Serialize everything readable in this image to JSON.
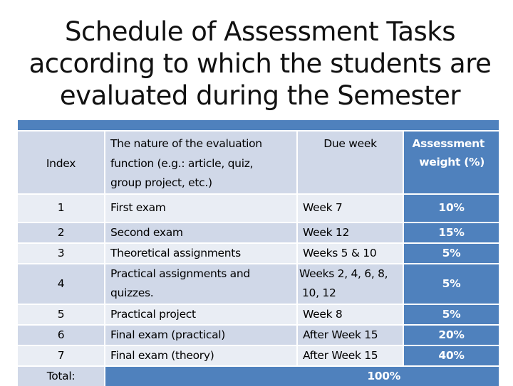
{
  "slide": {
    "title_lines": [
      "Schedule of Assessment Tasks",
      "according to which the students are",
      "evaluated during the Semester"
    ]
  },
  "colors": {
    "accent_blue": "#4f81bd",
    "row_dark": "#d0d8e8",
    "row_light": "#e9edf4"
  },
  "table": {
    "headers": {
      "index": "Index",
      "nature_lines": [
        "The nature of the evaluation",
        "function (e.g.: article, quiz,",
        "group project, etc.)"
      ],
      "due": "Due week",
      "weight_lines": [
        "Assessment",
        "weight (%)"
      ]
    },
    "rows": [
      {
        "index": "1",
        "nature": "First exam",
        "due": "Week 7",
        "weight": "10%"
      },
      {
        "index": "2",
        "nature": "Second exam",
        "due": "Week 12",
        "weight": "15%"
      },
      {
        "index": "3",
        "nature": "Theoretical assignments",
        "due": "Weeks 5 & 10",
        "weight": "5%"
      },
      {
        "index": "4",
        "nature_lines": [
          "Practical assignments and",
          "quizzes."
        ],
        "due_lines": [
          "Weeks 2, 4, 6, 8,",
          "10, 12"
        ],
        "weight": "5%"
      },
      {
        "index": "5",
        "nature": "Practical project",
        "due": "Week 8",
        "weight": "5%"
      },
      {
        "index": "6",
        "nature": "Final exam (practical)",
        "due": "After Week 15",
        "weight": "20%"
      },
      {
        "index": "7",
        "nature": "Final exam (theory)",
        "due": "After Week 15",
        "weight": "40%"
      }
    ],
    "total": {
      "label": "Total:",
      "value": "100%"
    }
  }
}
